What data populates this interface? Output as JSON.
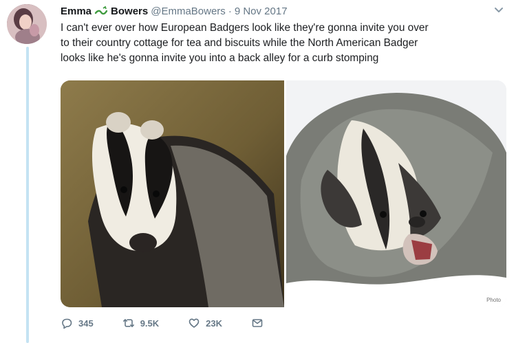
{
  "tweet": {
    "author_name_first": "Emma",
    "author_name_last": "Bowers",
    "handle": "@EmmaBowers",
    "separator": "·",
    "date": "9 Nov 2017",
    "text_lines": [
      "I can't ever over how European Badgers look like they're gonna invite you over",
      "to their country cottage for tea and biscuits while the North American Badger",
      "looks like he's gonna invite you into a back alley for a curb stomping"
    ],
    "photo_credit": "Photo"
  },
  "actions": {
    "reply_count": "345",
    "retweet_count": "9.5K",
    "like_count": "23K"
  },
  "icons": {
    "name_emoji": "dragon-icon",
    "menu": "chevron-down-icon",
    "reply": "reply-icon",
    "retweet": "retweet-icon",
    "like": "heart-icon",
    "message": "envelope-icon"
  },
  "colors": {
    "thread_line": "#c4e3f3",
    "meta_gray": "#657786",
    "text": "#14171a"
  }
}
